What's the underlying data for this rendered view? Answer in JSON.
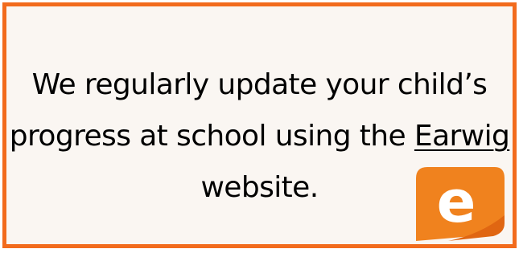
{
  "notice": {
    "line1": "We regularly update your child’s",
    "line2_before_link": "progress at school using the ",
    "link_text": "Earwig",
    "line3": "website."
  },
  "logo": {
    "icon": "earwig-e-logo-icon",
    "letter": "e"
  },
  "colors": {
    "border": "#f26b1d",
    "background": "#faf6f2",
    "logo_orange": "#f0821e",
    "logo_dark_orange": "#e06612",
    "text": "#000000"
  }
}
